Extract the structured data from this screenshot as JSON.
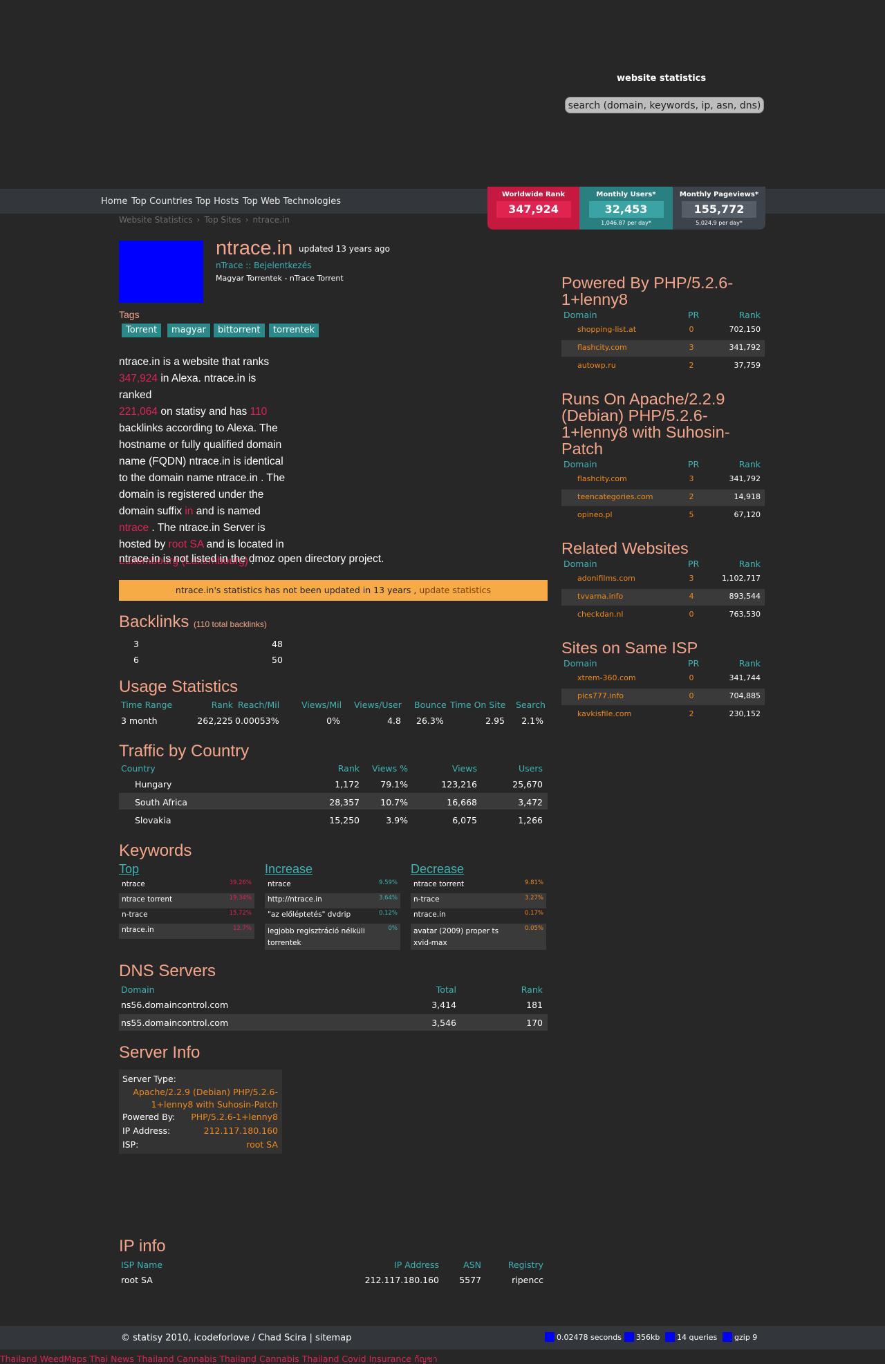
{
  "header": {
    "title": "website statistics",
    "search_placeholder": "search (domain, keywords, ip, asn, dns)"
  },
  "nav": [
    "Home",
    "Top Countries",
    "Top Hosts",
    "Top Web Technologies"
  ],
  "breadcrumb": [
    "Website Statistics",
    "Top Sites",
    "ntrace.in"
  ],
  "stats": [
    {
      "label": "Worldwide Rank",
      "value": "347,924",
      "sub": "",
      "color": "#c5193f",
      "inner": "#e0244f"
    },
    {
      "label": "Monthly Users*",
      "value": "32,453",
      "sub": "1,046.87 per day*",
      "color": "#2a8080",
      "inner": "#3aa3a3"
    },
    {
      "label": "Monthly Pageviews*",
      "value": "155,772",
      "sub": "5,024.9 per day*",
      "color": "#3c434b",
      "inner": "#555d66"
    }
  ],
  "site": {
    "name": "ntrace.in",
    "updated": "updated 13 years ago",
    "title": "nTrace :: Bejelentkezés",
    "description": "Magyar Torrentek - nTrace Torrent"
  },
  "tags_label": "Tags",
  "tags": [
    "Torrent",
    "magyar",
    "bittorrent",
    "torrentek"
  ],
  "summary": {
    "t1": "ntrace.in is a website that ranks",
    "rank": "347,924",
    "t2": " in Alexa. ntrace.in is ranked",
    "statisy_rank": "221,064",
    "t3": " on statisy and has ",
    "backlinks": "110",
    "t4": "backlinks according to Alexa. The hostname or fully qualified domain name (FQDN) ntrace.in is identical to the domain name ntrace.in . The domain is registered under the domain suffix ",
    "suffix": "in",
    "t5": " and is named",
    "named": "ntrace",
    "t6": " . The ntrace.in Server is hosted by ",
    "host": "root SA",
    "t7": " and is located in",
    "location": "Luxembourg (Luxembourg)",
    "t8": " .",
    "last": "ntrace.in is not listed in the dmoz open directory project."
  },
  "notice": {
    "text": "ntrace.in's statistics has not been updated in 13 years , ",
    "link": "update statistics"
  },
  "backlinks": {
    "title": "Backlinks",
    "total": "(110 total backlinks)",
    "rows": [
      [
        "3",
        "48"
      ],
      [
        "6",
        "50"
      ]
    ]
  },
  "usage": {
    "title": "Usage Statistics",
    "headers": [
      "Time Range",
      "Rank",
      "Reach/Mil",
      "Views/Mil",
      "Views/User",
      "Bounce",
      "Time On Site",
      "Search"
    ],
    "row": [
      "3 month",
      "262,225",
      "0.00053%",
      "0%",
      "4.8",
      "26.3%",
      "2.95",
      "2.1%"
    ]
  },
  "traffic": {
    "title": "Traffic by Country",
    "headers": [
      "Country",
      "Rank",
      "Views %",
      "Views",
      "Users"
    ],
    "rows": [
      [
        "Hungary",
        "1,172",
        "79.1%",
        "123,216",
        "25,670"
      ],
      [
        "South Africa",
        "28,357",
        "10.7%",
        "16,668",
        "3,472"
      ],
      [
        "Slovakia",
        "15,250",
        "3.9%",
        "6,075",
        "1,266"
      ]
    ]
  },
  "keywords": {
    "title": "Keywords",
    "top_label": "Top",
    "increase_label": "Increase",
    "decrease_label": "Decrease",
    "top": [
      [
        "ntrace",
        "39.26%"
      ],
      [
        "ntrace torrent",
        "19.34%"
      ],
      [
        "n-trace",
        "15.72%"
      ],
      [
        "ntrace.in",
        "12.7%"
      ]
    ],
    "increase": [
      [
        "ntrace",
        "9.59%"
      ],
      [
        "http://ntrace.in",
        "3.64%"
      ],
      [
        "\"az előléptetés\" dvdrip",
        "0.12%"
      ],
      [
        "legjobb regisztráció nélküli torrentek",
        "0%"
      ]
    ],
    "decrease": [
      [
        "ntrace torrent",
        "9.81%"
      ],
      [
        "n-trace",
        "3.27%"
      ],
      [
        "ntrace.in",
        "0.17%"
      ],
      [
        "avatar (2009) proper ts xvid-max",
        "0.05%"
      ]
    ]
  },
  "dns": {
    "title": "DNS Servers",
    "headers": [
      "Domain",
      "Total",
      "Rank"
    ],
    "rows": [
      [
        "ns56.domaincontrol.com",
        "3,414",
        "181"
      ],
      [
        "ns55.domaincontrol.com",
        "3,546",
        "170"
      ]
    ]
  },
  "server": {
    "title": "Server Info",
    "type_label": "Server Type:",
    "type_value": "Apache/2.2.9 (Debian) PHP/5.2.6-1+lenny8 with Suhosin-Patch",
    "powered_label": "Powered By:",
    "powered_value": "PHP/5.2.6-1+lenny8",
    "ip_label": "IP Address:",
    "ip_value": "212.117.180.160",
    "isp_label": "ISP:",
    "isp_value": "root SA"
  },
  "ipinfo": {
    "title": "IP info",
    "headers": [
      "ISP Name",
      "IP Address",
      "ASN",
      "Registry"
    ],
    "row": [
      "root SA",
      "212.117.180.160",
      "5577",
      "ripencc"
    ]
  },
  "sidebar": {
    "table_headers": [
      "Domain",
      "PR",
      "Rank"
    ],
    "sections": [
      {
        "title": "Powered By PHP/5.2.6-1+lenny8",
        "rows": [
          [
            "shopping-list.at",
            "0",
            "702,150"
          ],
          [
            "flashcity.com",
            "3",
            "341,792"
          ],
          [
            "autowp.ru",
            "2",
            "37,759"
          ]
        ]
      },
      {
        "title": "Runs On Apache/2.2.9 (Debian) PHP/5.2.6-1+lenny8 with Suhosin-Patch",
        "rows": [
          [
            "flashcity.com",
            "3",
            "341,792"
          ],
          [
            "teencategories.com",
            "2",
            "14,918"
          ],
          [
            "opineo.pl",
            "5",
            "67,120"
          ]
        ]
      },
      {
        "title": "Related Websites",
        "rows": [
          [
            "adonifilms.com",
            "3",
            "1,102,717"
          ],
          [
            "tvvarna.info",
            "4",
            "893,544"
          ],
          [
            "checkdan.nl",
            "0",
            "763,530"
          ]
        ]
      },
      {
        "title": "Sites on Same ISP",
        "rows": [
          [
            "xtrem-360.com",
            "0",
            "341,744"
          ],
          [
            "pics777.info",
            "0",
            "704,885"
          ],
          [
            "kavkisfile.com",
            "2",
            "230,152"
          ]
        ]
      }
    ]
  },
  "footer": {
    "text": "© statisy 2010, icodeforlove / Chad Scira | sitemap",
    "stats": [
      "0.02478 seconds",
      "356kb",
      "14 queries",
      "gzip 9"
    ],
    "ticker": "Thailand WeedMaps Thai News Thailand Cannabis Thailand Cannabis Thailand Covid Insurance กัญชา"
  }
}
